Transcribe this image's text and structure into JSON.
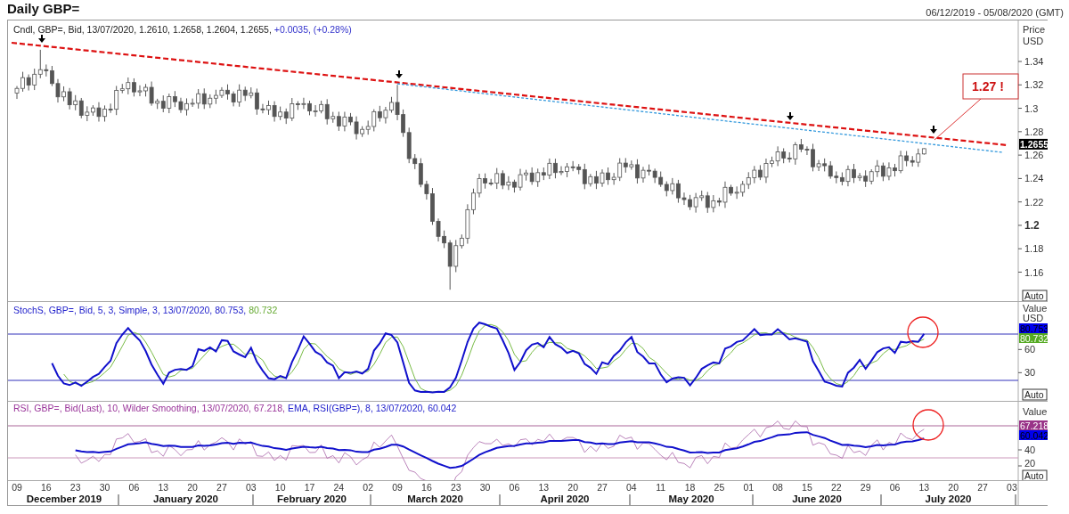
{
  "title": "Daily GBP=",
  "date_range": "06/12/2019 - 05/08/2020 (GMT)",
  "price_panel": {
    "legend": [
      {
        "text": "Cndl, GBP=, Bid, 13/07/2020, 1.2610, 1.2658, 1.2604, 1.2655,",
        "color": "#222222"
      },
      {
        "text": "+0.0035, (+0.28%)",
        "color": "#3333cc"
      }
    ],
    "axis_title": [
      "Price",
      "USD"
    ],
    "y_ticks": [
      {
        "label": "1.34",
        "major": false
      },
      {
        "label": "1.32",
        "major": false
      },
      {
        "label": "1.3",
        "major": false
      },
      {
        "label": "1.28",
        "major": false
      },
      {
        "label": "1.26",
        "major": false
      },
      {
        "label": "1.24",
        "major": false
      },
      {
        "label": "1.22",
        "major": false
      },
      {
        "label": "1.2",
        "major": true
      },
      {
        "label": "1.18",
        "major": false
      },
      {
        "label": "1.16",
        "major": false
      }
    ],
    "current_value": "1.2655",
    "callout": "1.27 !",
    "auto_button": "Auto"
  },
  "stoch_panel": {
    "legend": [
      {
        "text": "StochS, GBP=, Bid,  5, 3, Simple, 3, 13/07/2020, 80.753,",
        "color": "#2222cc"
      },
      {
        "text": "80.732",
        "color": "#66aa33"
      }
    ],
    "axis_title": [
      "Value",
      "USD"
    ],
    "y_ticks": [
      "60",
      "30"
    ],
    "badges": [
      {
        "text": "80.753",
        "color": "#0000ee"
      },
      {
        "text": "80.732",
        "color": "#55aa22"
      }
    ],
    "auto_button": "Auto"
  },
  "rsi_panel": {
    "legend": [
      {
        "text": "RSI, GBP=, Bid(Last),  10, Wilder Smoothing, 13/07/2020, 67.218,",
        "color": "#993399"
      },
      {
        "text": "EMA, RSI(GBP=),  8, 13/07/2020, 60.042",
        "color": "#2222cc"
      }
    ],
    "axis_title": [
      "Value"
    ],
    "y_ticks": [
      "40",
      "20"
    ],
    "badges": [
      {
        "text": "67.218",
        "color": "#993388"
      },
      {
        "text": "60.042",
        "color": "#0000ee"
      }
    ],
    "auto_button": "Auto"
  },
  "x_axis": {
    "day_labels": [
      "09",
      "16",
      "23",
      "30",
      "06",
      "13",
      "20",
      "27",
      "03",
      "10",
      "17",
      "24",
      "02",
      "09",
      "16",
      "23",
      "30",
      "06",
      "13",
      "20",
      "27",
      "04",
      "11",
      "18",
      "25",
      "01",
      "08",
      "15",
      "22",
      "29",
      "06",
      "13",
      "20",
      "27",
      "03"
    ],
    "months": [
      "December 2019",
      "January 2020",
      "February 2020",
      "March 2020",
      "April 2020",
      "May 2020",
      "June 2020",
      "July 2020"
    ]
  }
}
